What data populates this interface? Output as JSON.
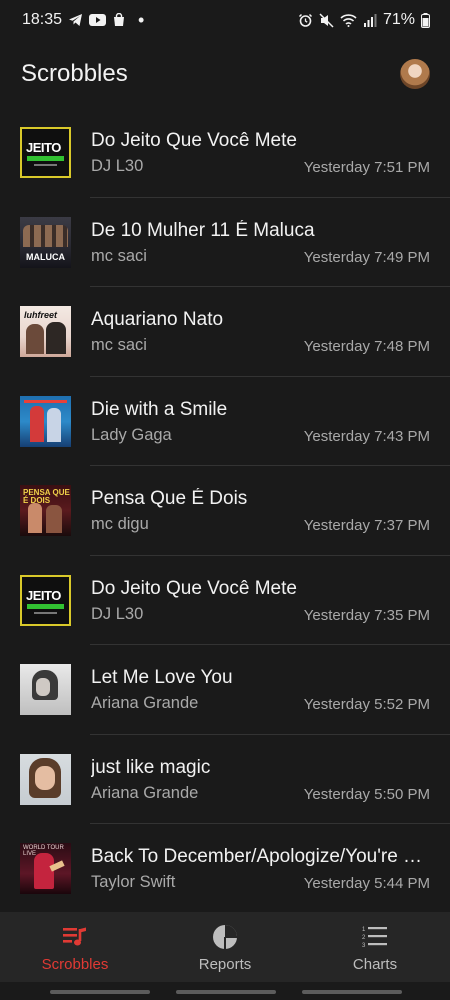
{
  "status_bar": {
    "time": "18:35",
    "battery": "71%",
    "left_icons": [
      "telegram-icon",
      "youtube-icon",
      "shopping-bag-icon",
      "notification-dot"
    ],
    "right_icons": [
      "alarm-icon",
      "mute-icon",
      "wifi-icon",
      "signal-icon",
      "battery-icon"
    ]
  },
  "header": {
    "title": "Scrobbles"
  },
  "scrobbles": [
    {
      "title": "Do Jeito Que Você Mete",
      "artist": "DJ L30",
      "time": "Yesterday 7:51 PM",
      "art": "jeito",
      "art_text": "JEITO"
    },
    {
      "title": "De 10 Mulher 11 É Maluca",
      "artist": "mc saci",
      "time": "Yesterday 7:49 PM",
      "art": "maluca",
      "art_text": "MALUCA"
    },
    {
      "title": "Aquariano Nato",
      "artist": "mc saci",
      "time": "Yesterday 7:48 PM",
      "art": "aquariano",
      "art_text": "Iuhfreet"
    },
    {
      "title": "Die with a Smile",
      "artist": "Lady Gaga",
      "time": "Yesterday 7:43 PM",
      "art": "gaga",
      "art_text": ""
    },
    {
      "title": "Pensa Que É Dois",
      "artist": "mc digu",
      "time": "Yesterday 7:37 PM",
      "art": "pensa",
      "art_text": "PENSA QUE É DOIS"
    },
    {
      "title": "Do Jeito Que Você Mete",
      "artist": "DJ L30",
      "time": "Yesterday 7:35 PM",
      "art": "jeito",
      "art_text": "JEITO"
    },
    {
      "title": "Let Me Love You",
      "artist": "Ariana Grande",
      "time": "Yesterday 5:52 PM",
      "art": "letme",
      "art_text": ""
    },
    {
      "title": "just like magic",
      "artist": "Ariana Grande",
      "time": "Yesterday 5:50 PM",
      "art": "magic",
      "art_text": ""
    },
    {
      "title": "Back To December/Apologize/You're Not Sorry",
      "artist": "Taylor Swift",
      "time": "Yesterday 5:44 PM",
      "art": "taylor",
      "art_text": "WORLD TOUR LIVE"
    }
  ],
  "bottom_nav": {
    "scrobbles_label": "Scrobbles",
    "reports_label": "Reports",
    "charts_label": "Charts",
    "active": "scrobbles"
  },
  "colors": {
    "background": "#1a1a1a",
    "nav_background": "#262626",
    "accent": "#e03a34",
    "primary_text": "#f2f2f2",
    "secondary_text": "#a9a9a9"
  }
}
